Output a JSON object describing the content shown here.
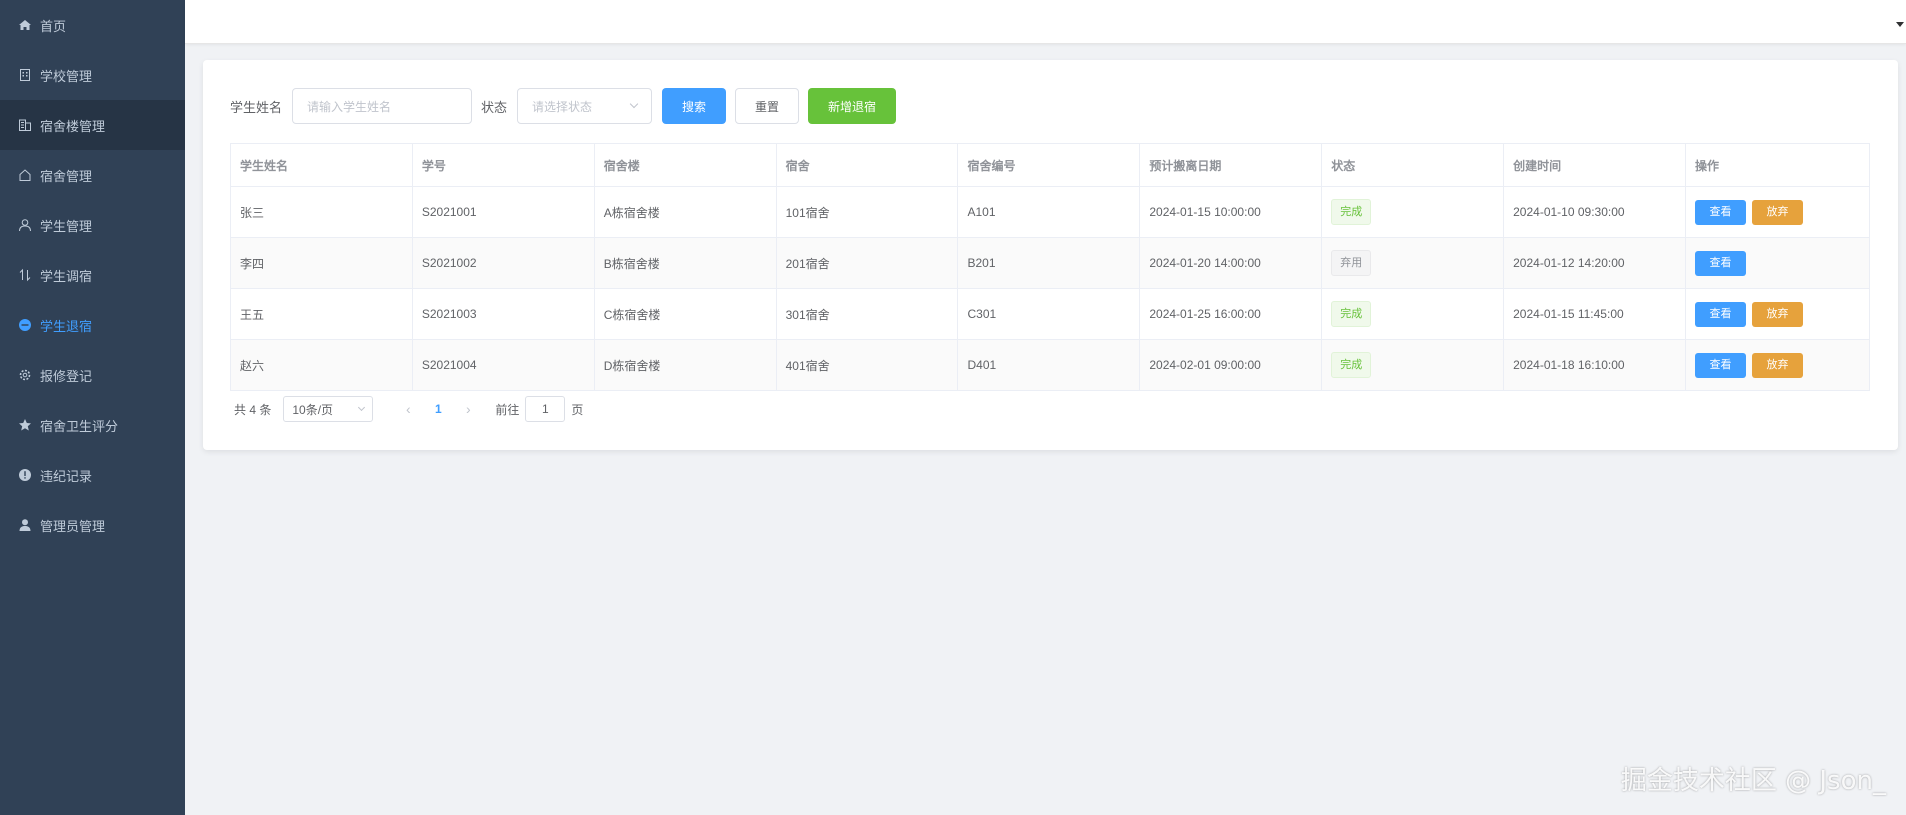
{
  "sidebar": {
    "items": [
      {
        "label": "首页",
        "icon": "home-icon"
      },
      {
        "label": "学校管理",
        "icon": "building-icon"
      },
      {
        "label": "宿舍楼管理",
        "icon": "office-icon"
      },
      {
        "label": "宿舍管理",
        "icon": "house-icon"
      },
      {
        "label": "学生管理",
        "icon": "user-icon"
      },
      {
        "label": "学生调宿",
        "icon": "sort-icon"
      },
      {
        "label": "学生退宿",
        "icon": "minus-circle-icon"
      },
      {
        "label": "报修登记",
        "icon": "gear-icon"
      },
      {
        "label": "宿舍卫生评分",
        "icon": "star-icon"
      },
      {
        "label": "违纪记录",
        "icon": "warning-icon"
      },
      {
        "label": "管理员管理",
        "icon": "admin-user-icon"
      }
    ],
    "active_color": "#409eff",
    "bg_color": "#304156"
  },
  "search": {
    "name_label": "学生姓名",
    "name_placeholder": "请输入学生姓名",
    "status_label": "状态",
    "status_placeholder": "请选择状态",
    "search_label": "搜索",
    "reset_label": "重置",
    "add_label": "新增退宿"
  },
  "table": {
    "headers": [
      "学生姓名",
      "学号",
      "宿舍楼",
      "宿舍",
      "宿舍编号",
      "预计搬离日期",
      "状态",
      "创建时间",
      "操作"
    ],
    "rows": [
      {
        "name": "张三",
        "id": "S2021001",
        "building": "A栋宿舍楼",
        "room": "101宿舍",
        "code": "A101",
        "leave": "2024-01-15 10:00:00",
        "status": "完成",
        "created": "2024-01-10 09:30:00"
      },
      {
        "name": "李四",
        "id": "S2021002",
        "building": "B栋宿舍楼",
        "room": "201宿舍",
        "code": "B201",
        "leave": "2024-01-20 14:00:00",
        "status": "弃用",
        "created": "2024-01-12 14:20:00"
      },
      {
        "name": "王五",
        "id": "S2021003",
        "building": "C栋宿舍楼",
        "room": "301宿舍",
        "code": "C301",
        "leave": "2024-01-25 16:00:00",
        "status": "完成",
        "created": "2024-01-15 11:45:00"
      },
      {
        "name": "赵六",
        "id": "S2021004",
        "building": "D栋宿舍楼",
        "room": "401宿舍",
        "code": "D401",
        "leave": "2024-02-01 09:00:00",
        "status": "完成",
        "created": "2024-01-18 16:10:00"
      }
    ],
    "view_label": "查看",
    "abandon_label": "放弃"
  },
  "pagination": {
    "total_text": "共 4 条",
    "page_size": "10条/页",
    "current_page": "1",
    "goto_prefix": "前往",
    "goto_value": "1",
    "goto_suffix": "页"
  },
  "watermark": "掘金技术社区 @ Json_"
}
